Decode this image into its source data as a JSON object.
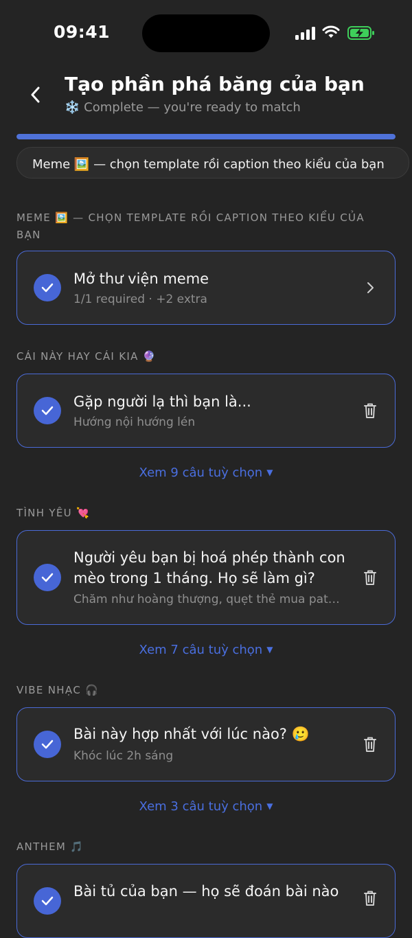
{
  "status_bar": {
    "time": "09:41"
  },
  "header": {
    "title": "Tạo phần phá băng của bạn",
    "subtitle_icon": "❄️",
    "subtitle": "Complete — you're ready to match"
  },
  "progress": {
    "percent": 100,
    "color": "#4f72d9"
  },
  "chip": {
    "label": "Meme 🖼️ — chọn template rồi caption theo kiểu của bạn"
  },
  "sections": [
    {
      "label": "Meme 🖼️ — chọn template rồi caption theo kiểu của bạn",
      "card": {
        "title": "Mở thư viện meme",
        "subtitle": "1/1 required · +2 extra",
        "action_icon": "chevron-right-icon"
      },
      "more": ""
    },
    {
      "label": "Cái này hay cái kia 🔮",
      "card": {
        "title": "Gặp người lạ thì bạn là...",
        "subtitle": "Hướng nội hướng lén",
        "action_icon": "trash-icon"
      },
      "more": "Xem 9 câu tuỳ chọn"
    },
    {
      "label": "Tình yêu 💘",
      "card": {
        "title": "Người yêu bạn bị hoá phép thành con mèo trong 1 tháng. Họ sẽ làm gì?",
        "subtitle": "Chăm như hoàng thượng, quẹt thẻ mua pate cho mèo",
        "action_icon": "trash-icon"
      },
      "more": "Xem 7 câu tuỳ chọn"
    },
    {
      "label": "Vibe nhạc 🎧",
      "card": {
        "title": "Bài này hợp nhất với lúc nào? 🥲",
        "subtitle": "Khóc lúc 2h sáng",
        "action_icon": "trash-icon"
      },
      "more": "Xem 3 câu tuỳ chọn"
    },
    {
      "label": "Anthem 🎵",
      "card": {
        "title": "Bài tủ của bạn — họ sẽ đoán bài nào",
        "subtitle": "",
        "action_icon": "trash-icon"
      },
      "more": ""
    }
  ],
  "colors": {
    "accent": "#4766d6",
    "link": "#4a6fe0",
    "background": "#242424",
    "card": "#2b2b2b"
  }
}
